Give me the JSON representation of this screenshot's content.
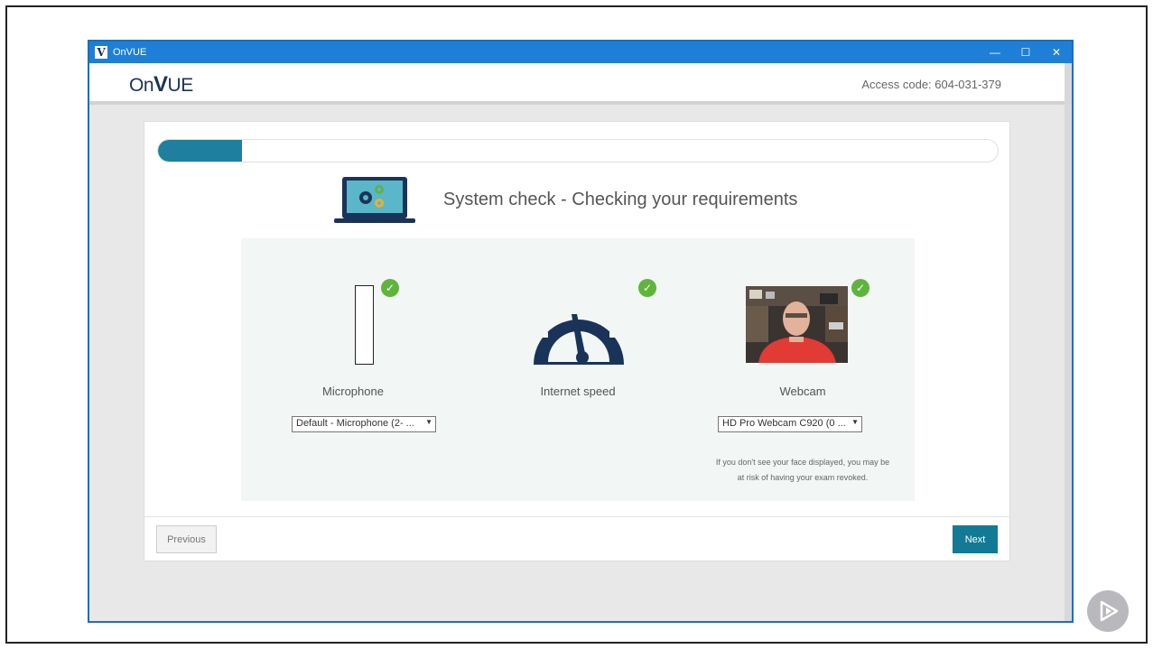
{
  "window": {
    "title": "OnVUE",
    "icon_letter": "V",
    "controls": {
      "minimize": "—",
      "maximize": "☐",
      "close": "✕"
    }
  },
  "header": {
    "logo_prefix": "On",
    "logo_v": "V",
    "logo_suffix": "UE",
    "access_code": "Access code: 604-031-379"
  },
  "progress": {
    "fraction": 0.1
  },
  "main": {
    "heading": "System check - Checking your requirements",
    "checks": [
      {
        "label": "Microphone",
        "status": "passed",
        "device": "Default - Microphone (2- ..."
      },
      {
        "label": "Internet speed",
        "status": "passed"
      },
      {
        "label": "Webcam",
        "status": "passed",
        "device": "HD Pro Webcam C920 (0 ..."
      }
    ],
    "webcam_note_line1": "If you don't see your face displayed, you may be",
    "webcam_note_line2": "at risk of having your exam revoked."
  },
  "footer": {
    "previous_label": "Previous",
    "next_label": "Next"
  },
  "colors": {
    "accent": "#127a95",
    "progress": "#1f7f9e",
    "check": "#5fb53c",
    "titlebar": "#1f7fd6"
  }
}
